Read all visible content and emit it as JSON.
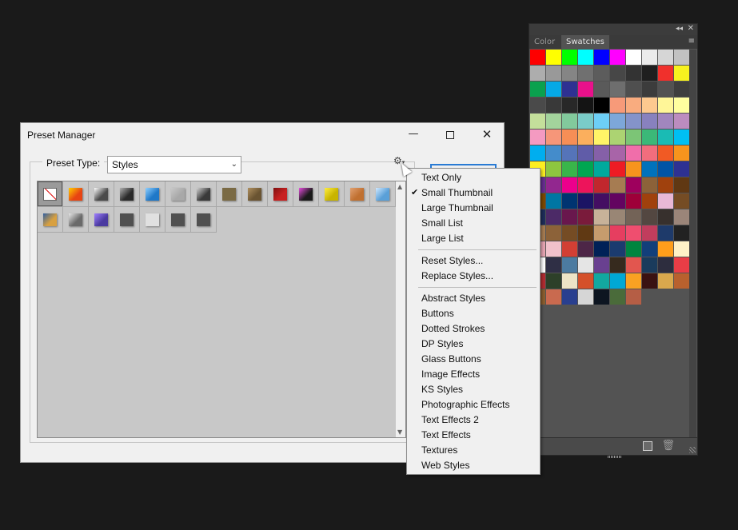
{
  "swatches_panel": {
    "tabs": [
      {
        "label": "Color"
      },
      {
        "label": "Swatches"
      }
    ],
    "active_tab": "Swatches",
    "colors": [
      "#fe0000",
      "#ffff00",
      "#00ff00",
      "#00ffff",
      "#0000ff",
      "#ff00ff",
      "#ffffff",
      "#ebebeb",
      "#d6d6d6",
      "#c2c2c2",
      "#adadad",
      "#999999",
      "#858585",
      "#707070",
      "#5c5c5c",
      "#474747",
      "#333333",
      "#1f1f1f",
      "#f0302c",
      "#f7f21f",
      "#0aa14e",
      "#05a9e6",
      "#2e3192",
      "#e9118b",
      "#5a5a5a",
      "#6e6e6e",
      "#4f4f4f",
      "#3c3c3c",
      "#525252",
      "#3e3e3e",
      "#4a4a4a",
      "#393939",
      "#282828",
      "#141414",
      "#000000",
      "#f79a79",
      "#f9ac7f",
      "#fdc98f",
      "#fff698",
      "#fffe9f",
      "#c4df9b",
      "#a3d39c",
      "#82ca9c",
      "#7accc8",
      "#6dcff6",
      "#7da7d9",
      "#8493ca",
      "#8881be",
      "#a186be",
      "#bc8cbf",
      "#f49ac1",
      "#f69679",
      "#f68e56",
      "#fbaf5d",
      "#fff467",
      "#acd372",
      "#7cc576",
      "#3bb878",
      "#1abbb4",
      "#00bff3",
      "#00aeef",
      "#448ccb",
      "#5574b9",
      "#605ca8",
      "#8560a8",
      "#a864a8",
      "#f06eaa",
      "#f26d7d",
      "#f15a24",
      "#f7941d",
      "#fcee21",
      "#8dc63f",
      "#39b54a",
      "#00a651",
      "#00a99d",
      "#ed1c24",
      "#f7941d",
      "#0072bc",
      "#0054a6",
      "#2e3192",
      "#662d91",
      "#92278f",
      "#ec008c",
      "#ed145b",
      "#c1272d",
      "#a67c52",
      "#9e005d",
      "#8c6239",
      "#a0410d",
      "#603813",
      "#7d4900",
      "#0076a3",
      "#003471",
      "#1b1464",
      "#440e62",
      "#630460",
      "#9e0039",
      "#a0410d",
      "#e8b8d6",
      "#754c24",
      "#1f2e5b",
      "#4c2a67",
      "#69174d",
      "#7a1b3b",
      "#c7b299",
      "#998675",
      "#736357",
      "#534741",
      "#37302d",
      "#9b8579",
      "#a67c52",
      "#8c6239",
      "#754c24",
      "#603913",
      "#c69c6d",
      "#e63e60",
      "#ef4e6f",
      "#c13d5d",
      "#1e3a6a",
      "#222222",
      "#e7a5b3",
      "#f1c1cb",
      "#d23f34",
      "#4d2647",
      "#002157",
      "#1b3b6f",
      "#00853f",
      "#123f7a",
      "#ff9e1b",
      "#fff2c7",
      "#ffffff",
      "#2f2f45",
      "#4c7ba1",
      "#e5e5e5",
      "#694090",
      "#362a1e",
      "#e2564f",
      "#1a3b5c",
      "#2d2d3e",
      "#e93d46",
      "#b32c31",
      "#2d4029",
      "#ede4c6",
      "#d4502a",
      "#12a8a0",
      "#00a8d4",
      "#f9a122",
      "#3a1212",
      "#d9a84d",
      "#b8612e",
      "#8b5e2f",
      "#c96a4f",
      "#293f8f",
      "#d6d6d6",
      "#0d1521",
      "#4a6b3a",
      "#b55e45"
    ]
  },
  "dialog": {
    "title": "Preset Manager",
    "minimize_glyph": "—",
    "close_glyph": "✕",
    "preset_type_label": "Preset Type:",
    "preset_type_value": "Styles",
    "gear_glyph": "⚙",
    "gear_caret": "▾"
  },
  "styles": [
    {
      "kind": "none"
    },
    {
      "kind": "chip",
      "color": "#e84412",
      "accent": "#ffd000"
    },
    {
      "kind": "chip",
      "color": "#4a4a4a",
      "accent": "#ffffff"
    },
    {
      "kind": "chip",
      "color": "#2a2a2a",
      "accent": "#b0b0b0"
    },
    {
      "kind": "chip",
      "color": "#1f78c8",
      "accent": "#8fd0ff"
    },
    {
      "kind": "chip",
      "color": "#a8a8a8",
      "accent": "#c8c8c8"
    },
    {
      "kind": "chip",
      "color": "#3a3a3a",
      "accent": "#d0d0d0"
    },
    {
      "kind": "chip",
      "color": "#7a6a44",
      "accent": "#7a6a44"
    },
    {
      "kind": "chip",
      "color": "#6a5432",
      "accent": "#b09060"
    },
    {
      "kind": "chip",
      "color": "#c82020",
      "accent": "#801010"
    },
    {
      "kind": "chip",
      "color": "#1a1a1a",
      "accent": "#e84de0"
    },
    {
      "kind": "chip",
      "color": "#c8b400",
      "accent": "#ffee40"
    },
    {
      "kind": "chip",
      "color": "#c07030",
      "accent": "#e0a070"
    },
    {
      "kind": "chip",
      "color": "#5aa0d8",
      "accent": "#d0e8ff"
    },
    {
      "kind": "chip",
      "color": "#d8a040",
      "accent": "#3060a0"
    },
    {
      "kind": "chip",
      "color": "#6a6a6a",
      "accent": "#e8e8e8"
    },
    {
      "kind": "chip",
      "color": "#4a3aa0",
      "accent": "#a080ff"
    },
    {
      "kind": "chip",
      "color": "#505050",
      "accent": "#505050"
    },
    {
      "kind": "chip",
      "color": "#e0e0e0",
      "accent": "#e0e0e0"
    },
    {
      "kind": "chip",
      "color": "#505050",
      "accent": "#505050"
    },
    {
      "kind": "chip",
      "color": "#505050",
      "accent": "#505050"
    }
  ],
  "menu": {
    "checkmark": "✔",
    "checked_item": "Small Thumbnail",
    "group1": [
      "Text Only",
      "Small Thumbnail",
      "Large Thumbnail",
      "Small List",
      "Large List"
    ],
    "group2": [
      "Reset Styles...",
      "Replace Styles..."
    ],
    "group3": [
      "Abstract Styles",
      "Buttons",
      "Dotted Strokes",
      "DP Styles",
      "Glass Buttons",
      "Image Effects",
      "KS Styles",
      "Photographic Effects",
      "Text Effects 2",
      "Text Effects",
      "Textures",
      "Web Styles"
    ]
  },
  "icons": {
    "panel_collapse": "◂◂",
    "panel_close": "✕",
    "panel_menu": "≡",
    "trash": "🗑",
    "scroll_up": "▲",
    "scroll_down": "▼",
    "select_caret": "⌄"
  }
}
